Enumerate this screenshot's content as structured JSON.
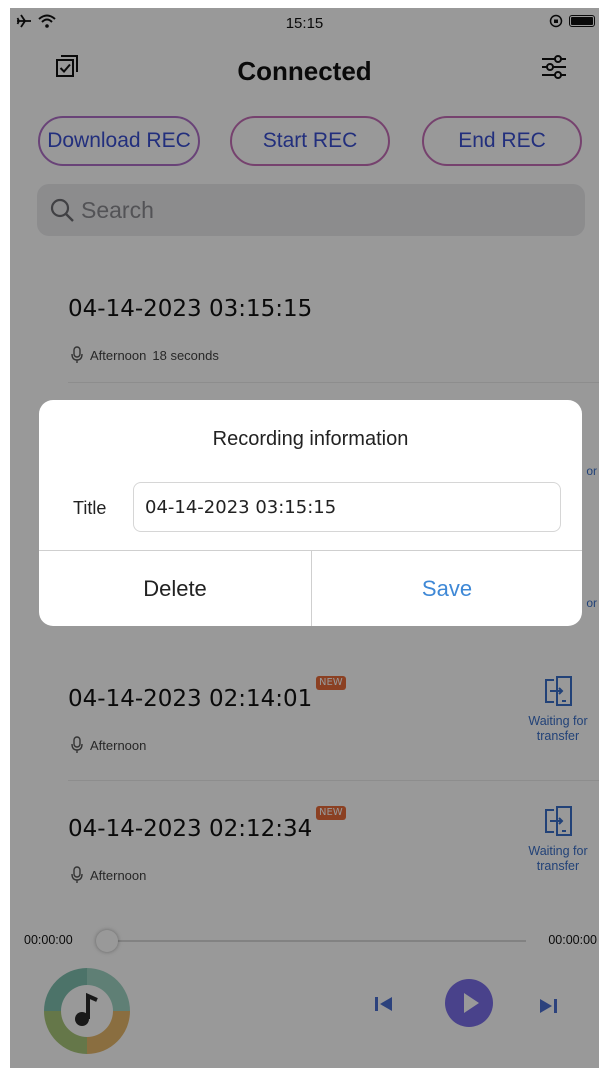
{
  "status_bar": {
    "time": "15:15"
  },
  "header": {
    "title": "Connected"
  },
  "rec_buttons": {
    "download": "Download REC",
    "start": "Start REC",
    "end": "End REC"
  },
  "search": {
    "placeholder": "Search"
  },
  "recordings": [
    {
      "title": "04-14-2023 03:15:15",
      "period": "Afternoon",
      "duration": "18 seconds"
    },
    {
      "title": "04-14-2023 02:14:01",
      "period": "Afternoon",
      "badge": "NEW",
      "status": "Waiting for transfer"
    },
    {
      "title": "04-14-2023 02:12:34",
      "period": "Afternoon",
      "badge": "NEW",
      "status": "Waiting for transfer"
    }
  ],
  "partial_status": {
    "first": "or",
    "second": "or"
  },
  "player": {
    "current_time": "00:00:00",
    "total_time": "00:00:00",
    "progress": 0
  },
  "dialog": {
    "title": "Recording information",
    "field_label": "Title",
    "field_value": "04-14-2023 03:15:15",
    "delete_label": "Delete",
    "save_label": "Save"
  },
  "colors": {
    "accent_blue": "#3a6fc8",
    "save_blue": "#3e88d6",
    "badge_orange": "#e86c3a",
    "button_border": "#c56fb8"
  }
}
